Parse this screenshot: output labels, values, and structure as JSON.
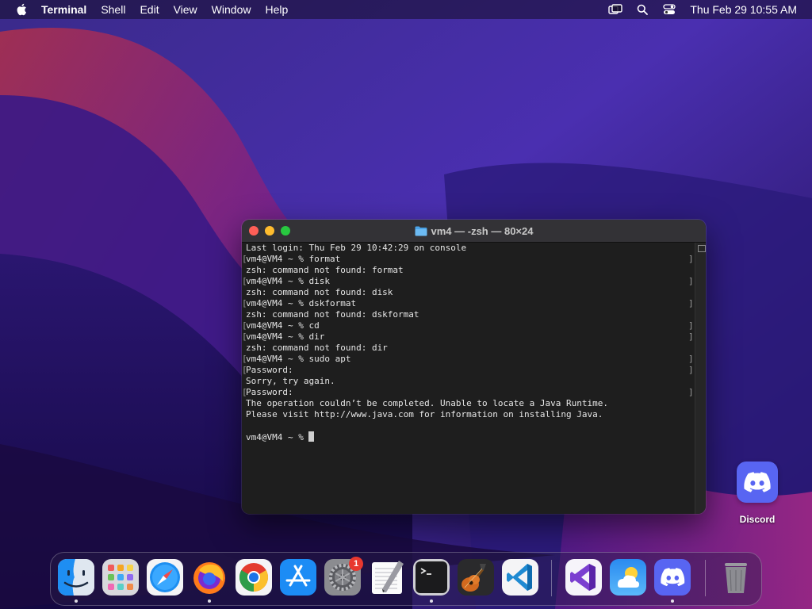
{
  "menubar": {
    "app_name": "Terminal",
    "items": [
      "Shell",
      "Edit",
      "View",
      "Window",
      "Help"
    ],
    "clock": "Thu Feb 29  10:55 AM",
    "status_icons": [
      "screen-mirroring-icon",
      "search-icon",
      "control-center-icon"
    ]
  },
  "terminal": {
    "title": "vm4 — -zsh — 80×24",
    "lines": [
      {
        "text": "Last login: Thu Feb 29 10:42:29 on console",
        "marked": false
      },
      {
        "text": "vm4@VM4 ~ % format",
        "marked": true
      },
      {
        "text": "zsh: command not found: format",
        "marked": false
      },
      {
        "text": "vm4@VM4 ~ % disk",
        "marked": true
      },
      {
        "text": "zsh: command not found: disk",
        "marked": false
      },
      {
        "text": "vm4@VM4 ~ % dskformat",
        "marked": true
      },
      {
        "text": "zsh: command not found: dskformat",
        "marked": false
      },
      {
        "text": "vm4@VM4 ~ % cd",
        "marked": true
      },
      {
        "text": "vm4@VM4 ~ % dir",
        "marked": true
      },
      {
        "text": "zsh: command not found: dir",
        "marked": false
      },
      {
        "text": "vm4@VM4 ~ % sudo apt",
        "marked": true
      },
      {
        "text": "Password:",
        "marked": true
      },
      {
        "text": "Sorry, try again.",
        "marked": false
      },
      {
        "text": "Password:",
        "marked": true
      },
      {
        "text": "The operation couldn’t be completed. Unable to locate a Java Runtime.",
        "marked": false
      },
      {
        "text": "Please visit http://www.java.com for information on installing Java.",
        "marked": false
      },
      {
        "text": "",
        "marked": false
      }
    ],
    "prompt": "vm4@VM4 ~ % "
  },
  "desktop": {
    "discord_label": "Discord"
  },
  "dock": {
    "apps": [
      {
        "name": "finder",
        "running": true
      },
      {
        "name": "launchpad",
        "running": false
      },
      {
        "name": "safari",
        "running": false
      },
      {
        "name": "firefox",
        "running": true
      },
      {
        "name": "chrome",
        "running": false
      },
      {
        "name": "app-store",
        "running": false
      },
      {
        "name": "system-settings",
        "running": false,
        "badge": "1"
      },
      {
        "name": "textedit",
        "running": false
      },
      {
        "name": "terminal",
        "running": true
      },
      {
        "name": "garageband",
        "running": false
      },
      {
        "name": "vscode",
        "running": false
      },
      {
        "name": "visual-studio",
        "running": false
      },
      {
        "name": "weather",
        "running": false
      },
      {
        "name": "discord",
        "running": true
      },
      {
        "name": "trash",
        "running": false
      }
    ],
    "system_settings_badge": "1"
  },
  "colors": {
    "terminal_bg": "#1e1e1e",
    "terminal_text": "#e6e6e6",
    "discord": "#5865f2",
    "badge": "#e8382f"
  }
}
